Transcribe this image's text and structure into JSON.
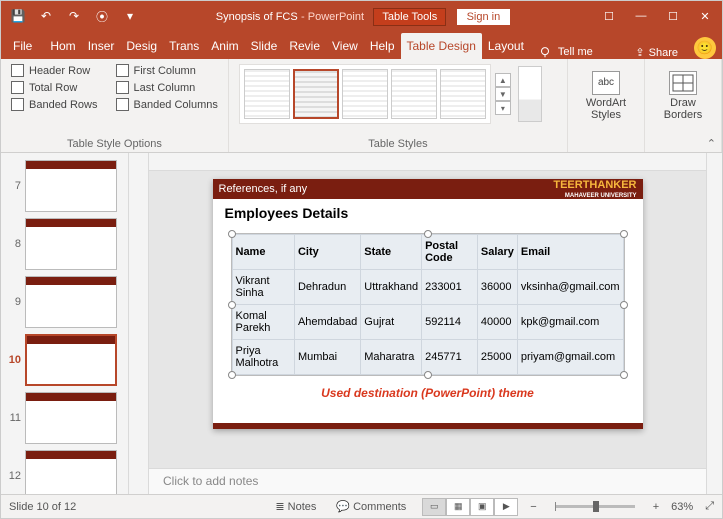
{
  "title": {
    "doc": "Synopsis of FCS",
    "app": "PowerPoint",
    "tools": "Table Tools",
    "signin": "Sign in"
  },
  "qat": {
    "save": "💾",
    "undo": "↶",
    "redo": "↷",
    "start": "⦿",
    "more": "▾"
  },
  "win": {
    "min": "—",
    "max": "☐",
    "close": "✕",
    "collapse": "☐"
  },
  "tabs": {
    "file": "File",
    "home": "Hom",
    "insert": "Inser",
    "design": "Desig",
    "transitions": "Trans",
    "animations": "Anim",
    "slideshow": "Slide",
    "review": "Revie",
    "view": "View",
    "help": "Help",
    "tabledesign": "Table Design",
    "layout": "Layout",
    "tellme": "Tell me",
    "share": "Share"
  },
  "ribbon": {
    "tso": {
      "header_row": "Header Row",
      "first_col": "First Column",
      "total_row": "Total Row",
      "last_col": "Last Column",
      "banded_rows": "Banded Rows",
      "banded_cols": "Banded Columns",
      "label": "Table Style Options"
    },
    "ts": {
      "label": "Table Styles"
    },
    "wa": {
      "label": "WordArt Styles",
      "icon": "abc"
    },
    "db": {
      "label": "Draw Borders"
    }
  },
  "thumbs": [
    "7",
    "8",
    "9",
    "10",
    "11",
    "12"
  ],
  "slide": {
    "ref": "References, if any",
    "univ1": "TEERTHANKER",
    "univ2": "MAHAVEER UNIVERSITY",
    "title": "Employees Details",
    "caption": "Used destination (PowerPoint) theme"
  },
  "chart_data": {
    "type": "table",
    "columns": [
      "Name",
      "City",
      "State",
      "Postal Code",
      "Salary",
      "Email"
    ],
    "rows": [
      [
        "Vikrant Sinha",
        "Dehradun",
        "Uttrakhand",
        "233001",
        "36000",
        "vksinha@gmail.com"
      ],
      [
        "Komal Parekh",
        "Ahemdabad",
        "Gujrat",
        "592114",
        "40000",
        "kpk@gmail.com"
      ],
      [
        "Priya Malhotra",
        "Mumbai",
        "Maharatra",
        "245771",
        "25000",
        "priyam@gmail.com"
      ]
    ]
  },
  "notes": "Click to add notes",
  "status": {
    "slide": "Slide 10 of 12",
    "notes": "Notes",
    "comments": "Comments",
    "zoom": "63%",
    "fit": "⤢"
  }
}
